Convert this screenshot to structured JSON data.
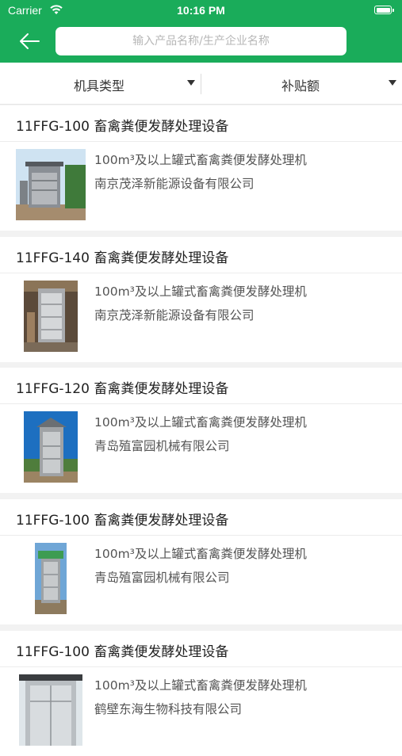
{
  "status_bar": {
    "carrier": "Carrier",
    "time": "10:16 PM"
  },
  "search": {
    "placeholder": "输入产品名称/生产企业名称",
    "value": ""
  },
  "filters": [
    {
      "label": "机具类型"
    },
    {
      "label": "补贴额"
    }
  ],
  "colors": {
    "brand_green": "#1aac5a",
    "page_bg": "#f2f2f2"
  },
  "products": [
    {
      "title": "11FFG-100 畜禽粪便发酵处理设备",
      "category": "100m³及以上罐式畜禽粪便发酵处理机",
      "company": "南京茂泽新能源设备有限公司"
    },
    {
      "title": "11FFG-140 畜禽粪便发酵处理设备",
      "category": "100m³及以上罐式畜禽粪便发酵处理机",
      "company": "南京茂泽新能源设备有限公司"
    },
    {
      "title": "11FFG-120 畜禽粪便发酵处理设备",
      "category": "100m³及以上罐式畜禽粪便发酵处理机",
      "company": "青岛殖富园机械有限公司"
    },
    {
      "title": "11FFG-100 畜禽粪便发酵处理设备",
      "category": "100m³及以上罐式畜禽粪便发酵处理机",
      "company": "青岛殖富园机械有限公司"
    },
    {
      "title": "11FFG-100 畜禽粪便发酵处理设备",
      "category": "100m³及以上罐式畜禽粪便发酵处理机",
      "company": "鹤壁东海生物科技有限公司"
    }
  ]
}
